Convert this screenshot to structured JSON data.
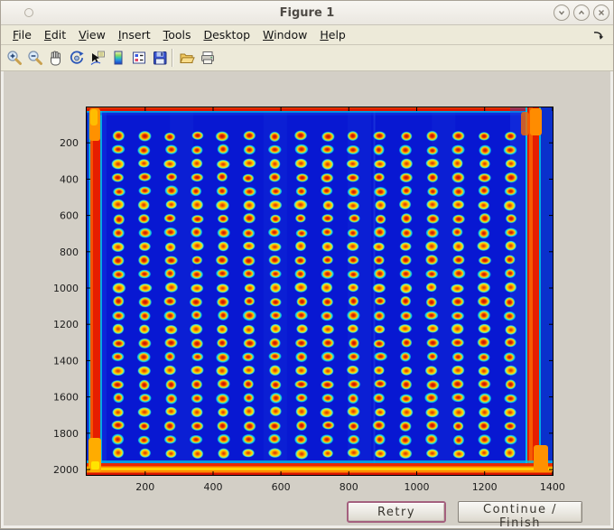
{
  "titlebar": {
    "title": "Figure 1",
    "window_buttons": [
      {
        "name": "shade",
        "icon": "chevron-down-icon"
      },
      {
        "name": "maximize",
        "icon": "chevron-up-icon"
      },
      {
        "name": "close",
        "icon": "close-icon"
      }
    ]
  },
  "menubar": {
    "items": [
      {
        "label": "File"
      },
      {
        "label": "Edit"
      },
      {
        "label": "View"
      },
      {
        "label": "Insert"
      },
      {
        "label": "Tools"
      },
      {
        "label": "Desktop"
      },
      {
        "label": "Window"
      },
      {
        "label": "Help"
      }
    ],
    "dock_icon": "dock-figure-arrow"
  },
  "toolbar": {
    "buttons": [
      "zoom-in",
      "zoom-out",
      "pan",
      "rotate-3d",
      "data-cursor",
      "insert-colorbar",
      "insert-legend",
      "save-figure",
      "open-file",
      "print-figure"
    ]
  },
  "buttons": {
    "retry": "Retry",
    "continue_finish": "Continue / Finish"
  },
  "chart_data": {
    "type": "heatmap",
    "title": "",
    "xlabel": "",
    "ylabel": "",
    "description": "Pseudocolor (jet colormap) scanned image of a 384-well microplate: 16 columns x 24 rows of warm spots (red centers, yellow rings, cyan halos) on a blue field with hot red/orange edges and corner blobs",
    "colormap": "jet",
    "xlim": [
      25,
      1403
    ],
    "ylim": [
      0,
      2035
    ],
    "x_ticks": [
      200,
      400,
      600,
      800,
      1000,
      1200,
      1400
    ],
    "y_ticks": [
      200,
      400,
      600,
      800,
      1000,
      1200,
      1400,
      1600,
      1800,
      2000
    ],
    "grid": {
      "cols": 16,
      "rows": 24,
      "x_start": 121,
      "x_pitch": 77,
      "y_start": 163,
      "y_pitch": 76
    },
    "colors": {
      "field_blue": "#0818d2",
      "spot_center_red": "#c41400",
      "spot_ring_yellow": "#ffd600",
      "spot_halo_cyan": "#18ccdc",
      "edge_red": "#e51e00",
      "edge_orange": "#ff9100",
      "edge_cyan": "#00c6e6",
      "axis": "#000000",
      "label": "#1c1c1c"
    }
  }
}
